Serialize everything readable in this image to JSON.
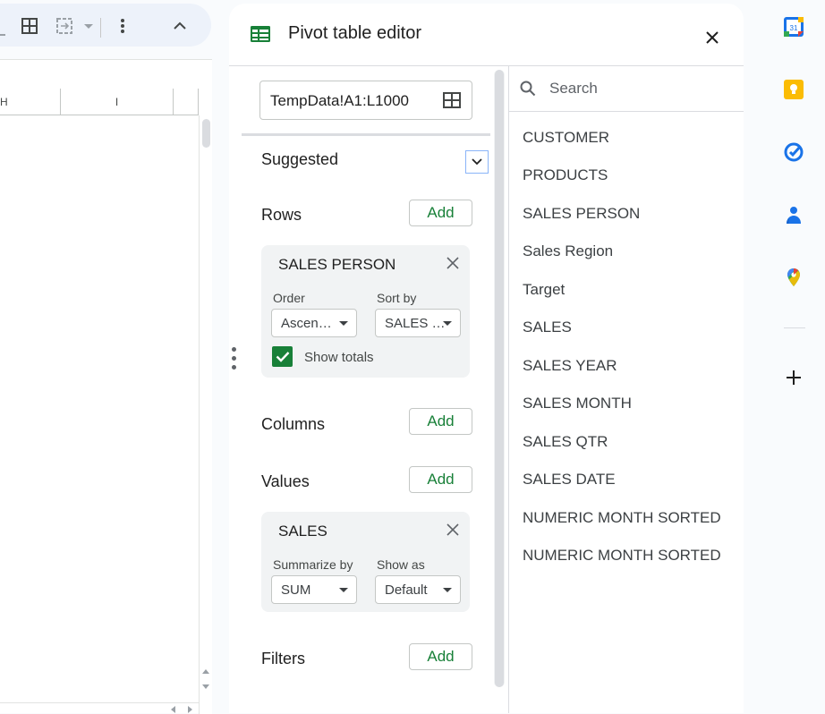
{
  "toolbar": {
    "icons": [
      "borders-icon",
      "merge-cells-icon",
      "more-vert-icon",
      "collapse-chevron-up-icon"
    ]
  },
  "sheet": {
    "columns": [
      "H",
      "I"
    ]
  },
  "pivot_editor": {
    "title": "Pivot table editor",
    "data_range": "TempData!A1:L1000",
    "suggested_label": "Suggested",
    "rows": {
      "label": "Rows",
      "add_label": "Add",
      "card": {
        "title": "SALES PERSON",
        "order_label": "Order",
        "order_value": "Ascen…",
        "sort_by_label": "Sort by",
        "sort_by_value": "SALES …",
        "show_totals_label": "Show totals",
        "show_totals_checked": true
      }
    },
    "columns": {
      "label": "Columns",
      "add_label": "Add"
    },
    "values": {
      "label": "Values",
      "add_label": "Add",
      "card": {
        "title": "SALES",
        "summarize_label": "Summarize by",
        "summarize_value": "SUM",
        "show_as_label": "Show as",
        "show_as_value": "Default"
      }
    },
    "filters": {
      "label": "Filters",
      "add_label": "Add"
    },
    "search_placeholder": "Search",
    "fields": [
      "CUSTOMER",
      "PRODUCTS",
      "SALES PERSON",
      "Sales Region",
      "Target",
      "SALES",
      "SALES YEAR",
      "SALES MONTH",
      "SALES QTR",
      "SALES DATE",
      "NUMERIC MONTH SORTED",
      "NUMERIC MONTH SORTED"
    ]
  },
  "side_panel": {
    "calendar_day": "31",
    "apps": [
      "calendar-icon",
      "keep-icon",
      "tasks-icon",
      "contacts-icon",
      "maps-icon"
    ],
    "colors": {
      "green": "#188038",
      "keep_yellow": "#fbbc04",
      "tasks_blue": "#1a73e8"
    }
  }
}
